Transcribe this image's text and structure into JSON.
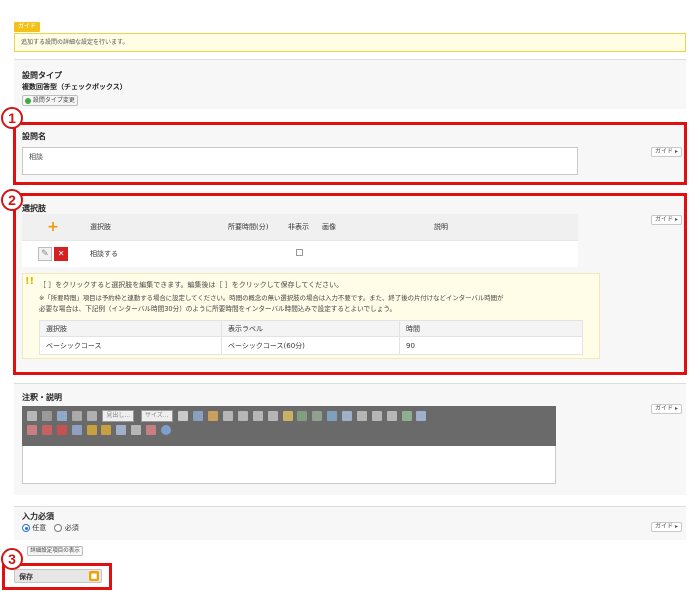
{
  "guide": {
    "tag": "ガイド",
    "text": "追加する設問の詳細な設定を行います。"
  },
  "question_type": {
    "label": "設問タイプ",
    "value": "複数回答型（チェックボックス）",
    "change_button": "設問タイプ変更"
  },
  "question_name": {
    "number": "1",
    "label": "設問名",
    "value": "相談",
    "guide_button": "ガイド ▸"
  },
  "choices": {
    "number": "2",
    "label": "選択肢",
    "guide_button": "ガイド ▸",
    "headers": [
      "選択肢",
      "所要時間(分)",
      "非表示",
      "画像",
      "説明"
    ],
    "rows": [
      {
        "choice": "相談する",
        "minutes": "",
        "hidden": false,
        "image": "",
        "desc": ""
      }
    ],
    "hint_line1": "［ ］をクリックすると選択肢を編集できます。編集後は［ ］をクリックして保存してください。",
    "hint_line2": "※「所要時間」項目は予約枠と連動する場合に設定してください。時間の概念の無い選択肢の場合は入力不要です。また、終了後の片付けなどインターバル時間が",
    "hint_line3": "必要な場合は、下記例（インターバル時間30分）のように所要時間をインターバル時間込みで設定するとよいでしょう。",
    "example_headers": [
      "選択肢",
      "表示ラベル",
      "時間"
    ],
    "example_row": [
      "ベーシックコース",
      "ベーシックコース(60分)",
      "90"
    ]
  },
  "notes": {
    "label": "注釈・説明",
    "guide_button": "ガイド ▸",
    "select1": "見出し...",
    "select2": "サイズ..."
  },
  "required": {
    "label": "入力必須",
    "option_optional": "任意",
    "option_required": "必須",
    "guide_button": "ガイド ▸"
  },
  "detail_button": "詳細設定項目の表示",
  "save": {
    "number": "3",
    "label": "保存"
  }
}
